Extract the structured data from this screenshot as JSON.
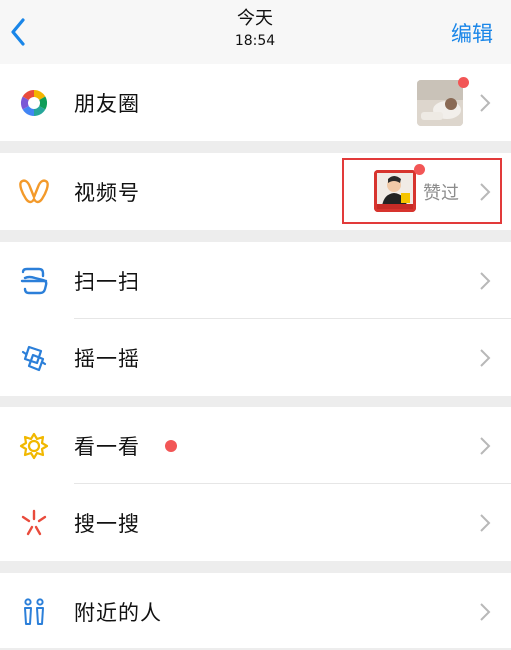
{
  "nav": {
    "title": "今天",
    "subtitle": "18:54",
    "edit_label": "编辑"
  },
  "items": [
    {
      "label": "朋友圈",
      "icon": "moments-icon"
    },
    {
      "label": "视频号",
      "icon": "channels-icon",
      "status": "赞过"
    },
    {
      "label": "扫一扫",
      "icon": "scan-icon"
    },
    {
      "label": "摇一摇",
      "icon": "shake-icon"
    },
    {
      "label": "看一看",
      "icon": "top-stories-icon"
    },
    {
      "label": "搜一搜",
      "icon": "search-icon"
    },
    {
      "label": "附近的人",
      "icon": "people-nearby-icon"
    }
  ],
  "colors": {
    "accent": "#1a86e8",
    "badge": "#f25656",
    "highlight_box": "#e23a3a"
  }
}
